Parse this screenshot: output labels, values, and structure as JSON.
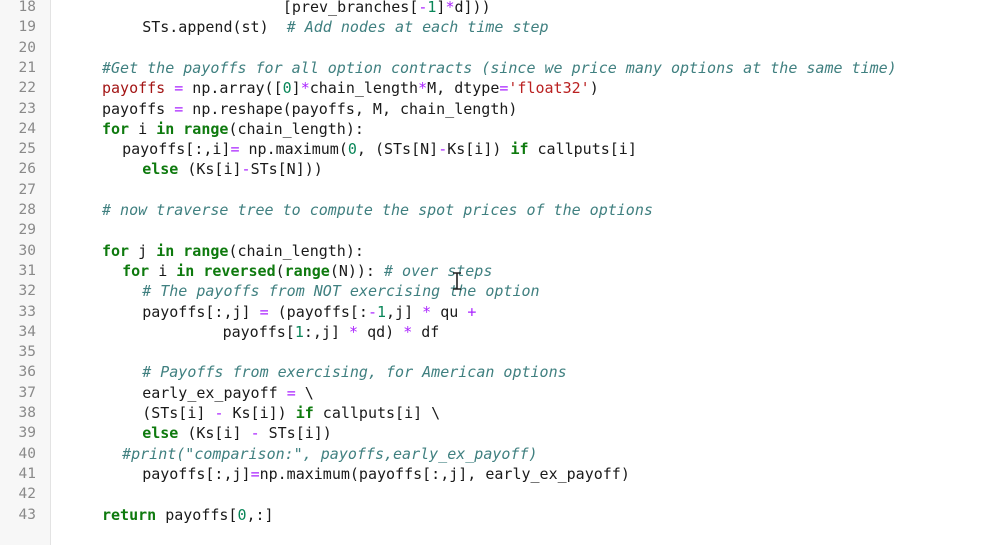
{
  "editor": {
    "lines": [
      {
        "n": "18",
        "indent": 11,
        "tokens": [
          [
            "text",
            "[prev_branches["
          ],
          [
            "op",
            "-"
          ],
          [
            "num",
            "1"
          ],
          [
            "text",
            "]"
          ],
          [
            "op",
            "*"
          ],
          [
            "text",
            "d]))"
          ]
        ]
      },
      {
        "n": "19",
        "indent": 4,
        "tokens": [
          [
            "text",
            "STs.append(st)  "
          ],
          [
            "cmt",
            "# Add nodes at each time step"
          ]
        ]
      },
      {
        "n": "20",
        "indent": 0,
        "tokens": []
      },
      {
        "n": "21",
        "indent": 2,
        "tokens": [
          [
            "cmt",
            "#Get the payoffs for all option contracts (since we price many options at the same time)"
          ]
        ]
      },
      {
        "n": "22",
        "indent": 2,
        "tokens": [
          [
            "var",
            "payoffs"
          ],
          [
            "text",
            " "
          ],
          [
            "op",
            "="
          ],
          [
            "text",
            " np.array(["
          ],
          [
            "num",
            "0"
          ],
          [
            "text",
            "]"
          ],
          [
            "op",
            "*"
          ],
          [
            "text",
            "chain_length"
          ],
          [
            "op",
            "*"
          ],
          [
            "text",
            "M, dtype"
          ],
          [
            "op",
            "="
          ],
          [
            "str",
            "'float32'"
          ],
          [
            "text",
            ")"
          ]
        ]
      },
      {
        "n": "23",
        "indent": 2,
        "tokens": [
          [
            "text",
            "payoffs "
          ],
          [
            "op",
            "="
          ],
          [
            "text",
            " np.reshape(payoffs, M, chain_length)"
          ]
        ]
      },
      {
        "n": "24",
        "indent": 2,
        "tokens": [
          [
            "kw",
            "for"
          ],
          [
            "text",
            " i "
          ],
          [
            "kw",
            "in"
          ],
          [
            "text",
            " "
          ],
          [
            "kw",
            "range"
          ],
          [
            "text",
            "(chain_length):"
          ]
        ]
      },
      {
        "n": "25",
        "indent": 3,
        "tokens": [
          [
            "text",
            "payoffs[:,i]"
          ],
          [
            "op",
            "="
          ],
          [
            "text",
            " np.maximum("
          ],
          [
            "num",
            "0"
          ],
          [
            "text",
            ", (STs[N]"
          ],
          [
            "op",
            "-"
          ],
          [
            "text",
            "Ks[i]) "
          ],
          [
            "kw",
            "if"
          ],
          [
            "text",
            " callputs[i]"
          ]
        ]
      },
      {
        "n": "26",
        "indent": 4,
        "tokens": [
          [
            "kw",
            "else"
          ],
          [
            "text",
            " (Ks[i]"
          ],
          [
            "op",
            "-"
          ],
          [
            "text",
            "STs[N]))"
          ]
        ]
      },
      {
        "n": "27",
        "indent": 0,
        "tokens": []
      },
      {
        "n": "28",
        "indent": 2,
        "tokens": [
          [
            "cmt",
            "# now traverse tree to compute the spot prices of the options"
          ]
        ]
      },
      {
        "n": "29",
        "indent": 0,
        "tokens": []
      },
      {
        "n": "30",
        "indent": 2,
        "tokens": [
          [
            "kw",
            "for"
          ],
          [
            "text",
            " j "
          ],
          [
            "kw",
            "in"
          ],
          [
            "text",
            " "
          ],
          [
            "kw",
            "range"
          ],
          [
            "text",
            "(chain_length):"
          ]
        ]
      },
      {
        "n": "31",
        "indent": 3,
        "tokens": [
          [
            "kw",
            "for"
          ],
          [
            "text",
            " i "
          ],
          [
            "kw",
            "in"
          ],
          [
            "text",
            " "
          ],
          [
            "kw",
            "reversed"
          ],
          [
            "text",
            "("
          ],
          [
            "kw",
            "range"
          ],
          [
            "text",
            "(N)): "
          ],
          [
            "cmt",
            "# over steps"
          ]
        ]
      },
      {
        "n": "32",
        "indent": 4,
        "tokens": [
          [
            "cmt",
            "# The payoffs from NOT exercising the option"
          ]
        ]
      },
      {
        "n": "33",
        "indent": 4,
        "tokens": [
          [
            "text",
            "payoffs[:,j] "
          ],
          [
            "op",
            "="
          ],
          [
            "text",
            " (payoffs[:"
          ],
          [
            "op",
            "-"
          ],
          [
            "num",
            "1"
          ],
          [
            "text",
            ",j] "
          ],
          [
            "op",
            "*"
          ],
          [
            "text",
            " qu "
          ],
          [
            "op",
            "+"
          ]
        ]
      },
      {
        "n": "34",
        "indent": 8,
        "tokens": [
          [
            "text",
            "payoffs["
          ],
          [
            "num",
            "1"
          ],
          [
            "text",
            ":,j] "
          ],
          [
            "op",
            "*"
          ],
          [
            "text",
            " qd) "
          ],
          [
            "op",
            "*"
          ],
          [
            "text",
            " df"
          ]
        ]
      },
      {
        "n": "35",
        "indent": 0,
        "tokens": []
      },
      {
        "n": "36",
        "indent": 4,
        "tokens": [
          [
            "cmt",
            "# Payoffs from exercising, for American options"
          ]
        ]
      },
      {
        "n": "37",
        "indent": 4,
        "tokens": [
          [
            "text",
            "early_ex_payoff "
          ],
          [
            "op",
            "="
          ],
          [
            "text",
            " \\"
          ]
        ]
      },
      {
        "n": "38",
        "indent": 4,
        "tokens": [
          [
            "text",
            "(STs[i] "
          ],
          [
            "op",
            "-"
          ],
          [
            "text",
            " Ks[i]) "
          ],
          [
            "kw",
            "if"
          ],
          [
            "text",
            " callputs[i] \\"
          ]
        ]
      },
      {
        "n": "39",
        "indent": 4,
        "tokens": [
          [
            "kw",
            "else"
          ],
          [
            "text",
            " (Ks[i] "
          ],
          [
            "op",
            "-"
          ],
          [
            "text",
            " STs[i])"
          ]
        ]
      },
      {
        "n": "40",
        "indent": 3,
        "tokens": [
          [
            "cmt",
            "#print(\"comparison:\", payoffs,early_ex_payoff)"
          ]
        ]
      },
      {
        "n": "41",
        "indent": 4,
        "tokens": [
          [
            "text",
            "payoffs[:,j]"
          ],
          [
            "op",
            "="
          ],
          [
            "text",
            "np.maximum(payoffs[:,j], early_ex_payoff)"
          ]
        ]
      },
      {
        "n": "42",
        "indent": 0,
        "tokens": []
      },
      {
        "n": "43",
        "indent": 2,
        "tokens": [
          [
            "kw",
            "return"
          ],
          [
            "text",
            " payoffs["
          ],
          [
            "num",
            "0"
          ],
          [
            "text",
            ",:]"
          ]
        ]
      }
    ]
  }
}
